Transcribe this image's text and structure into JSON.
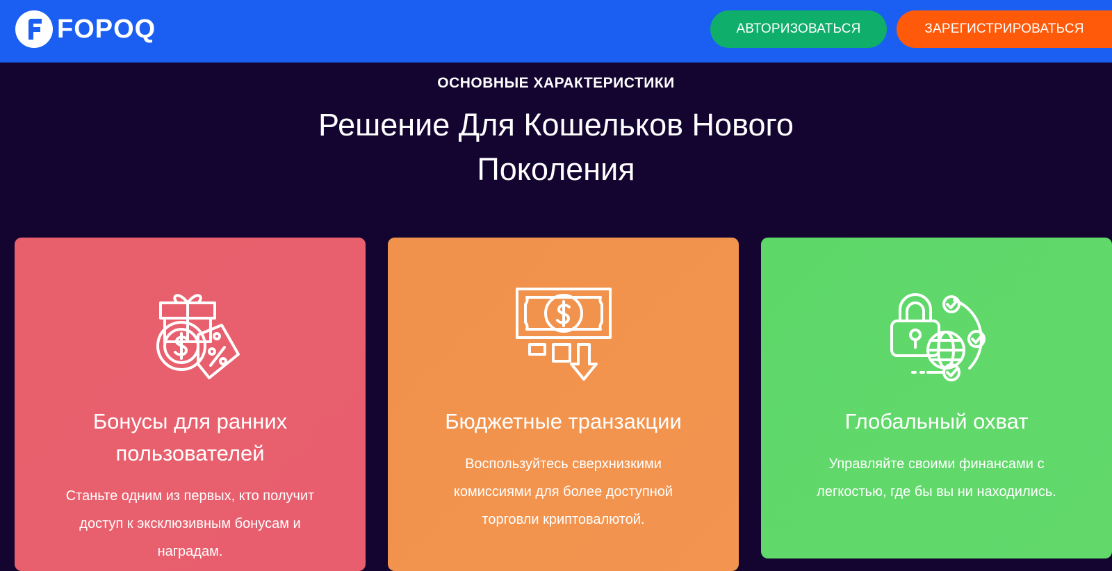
{
  "header": {
    "logo_text": "FOPOQ",
    "brand_color": "#1a5ff2",
    "login_label": "АВТОРИЗОВАТЬСЯ",
    "register_label": "ЗАРЕГИСТРИРОВАТЬСЯ"
  },
  "hero": {
    "eyebrow": "ОСНОВНЫЕ ХАРАКТЕРИСТИКИ",
    "headline": "Решение Для Кошельков Нового Поколения"
  },
  "cards": [
    {
      "icon": "gift-coin-discount-icon",
      "color": "#e8606c",
      "title": "Бонусы для ранних пользователей",
      "description": "Станьте одним из первых, кто получит доступ к эксклюзивным бонусам и наградам."
    },
    {
      "icon": "banknote-download-icon",
      "color": "#f0924b",
      "title": "Бюджетные транзакции",
      "description": "Воспользуйтесь сверхнизкими комиссиями для более доступной торговли криптовалютой."
    },
    {
      "icon": "lock-globe-check-icon",
      "color": "#5ed769",
      "title": "Глобальный охват",
      "description": "Управляйте своими финансами с легкостью, где бы вы ни находились."
    }
  ]
}
